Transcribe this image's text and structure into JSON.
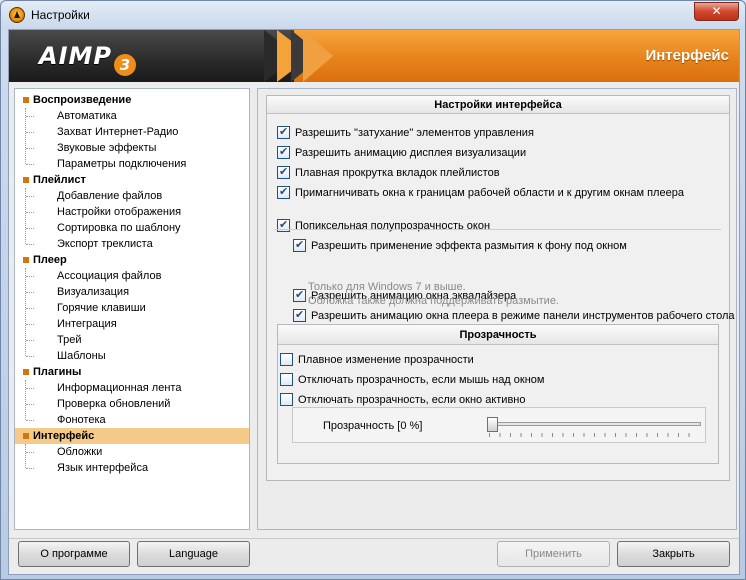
{
  "window": {
    "title": "Настройки",
    "close_glyph": "✕"
  },
  "banner": {
    "logo": "AIMP",
    "logo_version": "3",
    "section_title": "Интерфейс"
  },
  "tree": {
    "groups": [
      {
        "label": "Воспроизведение",
        "children": [
          "Автоматика",
          "Захват Интернет-Радио",
          "Звуковые эффекты",
          "Параметры подключения"
        ]
      },
      {
        "label": "Плейлист",
        "children": [
          "Добавление файлов",
          "Настройки отображения",
          "Сортировка по шаблону",
          "Экспорт треклиста"
        ]
      },
      {
        "label": "Плеер",
        "children": [
          "Ассоциация файлов",
          "Визуализация",
          "Горячие клавиши",
          "Интеграция",
          "Трей",
          "Шаблоны"
        ]
      },
      {
        "label": "Плагины",
        "children": [
          "Информационная лента",
          "Проверка обновлений",
          "Фонотека"
        ]
      },
      {
        "label": "Интерфейс",
        "children": [
          "Обложки",
          "Язык интерфейса"
        ],
        "selected": true
      }
    ]
  },
  "settings": {
    "header": "Настройки интерфейса",
    "checkboxes": [
      {
        "label": "Разрешить \"затухание\" элементов управления",
        "checked": true
      },
      {
        "label": "Разрешить анимацию дисплея визуализации",
        "checked": true
      },
      {
        "label": "Плавная прокрутка вкладок плейлистов",
        "checked": true
      },
      {
        "label": "Примагничивать окна к границам рабочей области и к другим окнам плеера",
        "checked": true
      },
      {
        "label": "Попиксельная полупрозрачность окон",
        "checked": true
      },
      {
        "label": "Разрешить применение эффекта размытия к фону под окном",
        "checked": true
      },
      {
        "label": "Разрешить анимацию окна эквалайзера",
        "checked": true
      },
      {
        "label": "Разрешить анимацию окна плеера в режиме панели инструментов рабочего стола",
        "checked": true
      }
    ],
    "hint_line1": "Только для Windows 7 и выше.",
    "hint_line2": "Обложка также должна поддерживать размытие."
  },
  "transparency": {
    "header": "Прозрачность",
    "checkboxes": [
      {
        "label": "Плавное изменение прозрачности",
        "checked": false
      },
      {
        "label": "Отключать прозрачность, если мышь над окном",
        "checked": false
      },
      {
        "label": "Отключать прозрачность, если окно активно",
        "checked": false
      }
    ],
    "slider_label": "Прозрачность [0 %]",
    "slider_value": 0
  },
  "buttons": {
    "about": "О программе",
    "language": "Language",
    "apply": "Применить",
    "close": "Закрыть"
  },
  "colors": {
    "accent_orange": "#e8831b",
    "selected_item": "#f5c98a"
  }
}
